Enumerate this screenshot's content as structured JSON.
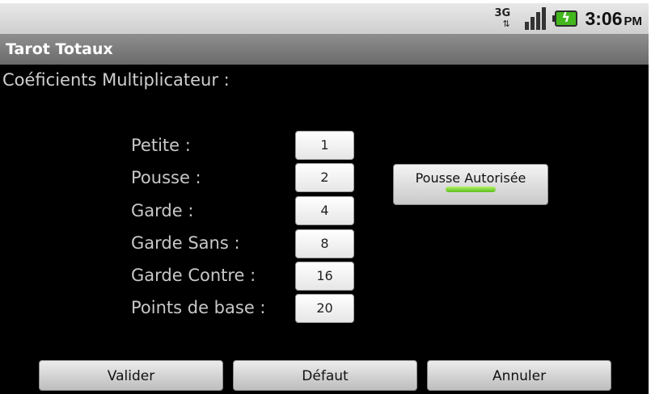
{
  "status_bar": {
    "network_label": "3G",
    "network_icon": "3g-data-icon",
    "signal_icon": "signal-strength-icon",
    "battery_icon": "battery-charging-icon",
    "battery_color": "#43b71e",
    "time": "3:06",
    "ampm": "PM"
  },
  "app": {
    "title": "Tarot Totaux"
  },
  "section": {
    "label": "Coéficients Multiplicateur :"
  },
  "rows": [
    {
      "label": "Petite :",
      "value": "1"
    },
    {
      "label": "Pousse :",
      "value": "2"
    },
    {
      "label": "Garde :",
      "value": "4"
    },
    {
      "label": "Garde Sans :",
      "value": "8"
    },
    {
      "label": "Garde Contre :",
      "value": "16"
    },
    {
      "label": "Points de base :",
      "value": "20"
    }
  ],
  "toggle": {
    "label": "Pousse Autorisée",
    "checked": true,
    "indicator_color": "#59c01a"
  },
  "buttons": {
    "validate": "Valider",
    "default": "Défaut",
    "cancel": "Annuler"
  }
}
